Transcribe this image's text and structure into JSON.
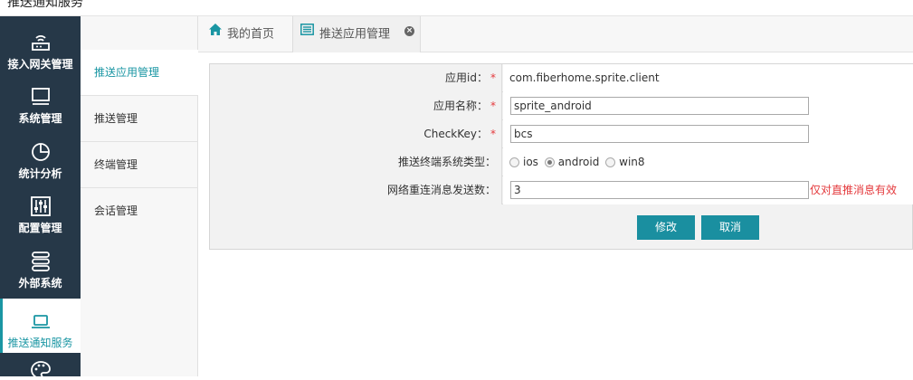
{
  "header": {
    "title": "推送通知服务"
  },
  "leftnav": {
    "items": [
      {
        "label": "接入网关管理",
        "icon": "router-icon"
      },
      {
        "label": "系统管理",
        "icon": "monitor-icon"
      },
      {
        "label": "统计分析",
        "icon": "pie-chart-icon"
      },
      {
        "label": "配置管理",
        "icon": "sliders-icon"
      },
      {
        "label": "外部系统",
        "icon": "server-stack-icon"
      },
      {
        "label": "推送通知服务",
        "icon": "laptop-icon"
      },
      {
        "label": "",
        "icon": "palette-icon"
      }
    ],
    "active_index": 5,
    "accent": "#1a96a3",
    "bg": "#263848"
  },
  "submenu": {
    "items": [
      {
        "label": "推送应用管理"
      },
      {
        "label": "推送管理"
      },
      {
        "label": "终端管理"
      },
      {
        "label": "会话管理"
      }
    ],
    "active_index": 0
  },
  "tabs": {
    "home": {
      "label": "我的首页",
      "icon": "home-icon"
    },
    "current": {
      "label": "推送应用管理",
      "icon": "list-icon",
      "close": "×"
    }
  },
  "form": {
    "app_id": {
      "label": "应用id：",
      "value": "com.fiberhome.sprite.client"
    },
    "app_name": {
      "label": "应用名称：",
      "value": "sprite_android"
    },
    "checkkey": {
      "label": "CheckKey：",
      "value": "bcs"
    },
    "os_type": {
      "label": "推送终端系统类型：",
      "options": [
        "ios",
        "android",
        "win8"
      ],
      "selected": "android"
    },
    "retry": {
      "label": "网络重连消息发送数：",
      "value": "3",
      "hint": "仅对直推消息有效"
    },
    "required_mark": "*",
    "buttons": {
      "modify": "修改",
      "cancel": "取消"
    }
  }
}
